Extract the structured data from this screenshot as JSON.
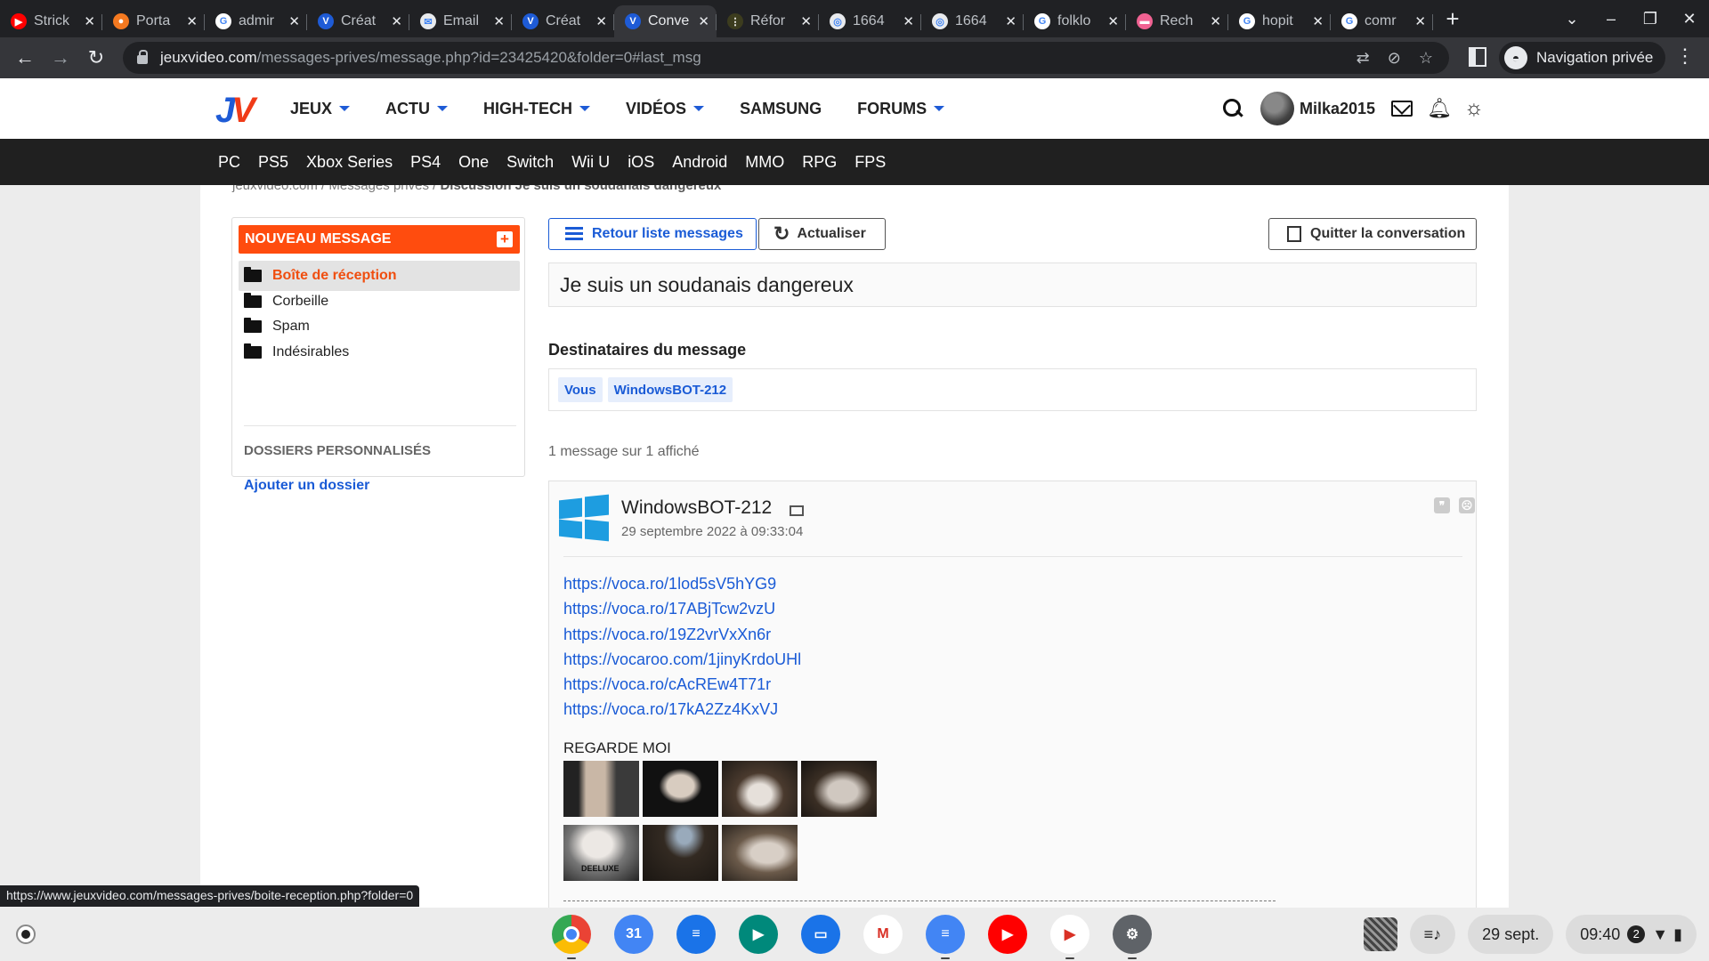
{
  "browser": {
    "tabs": [
      {
        "title": "Strick",
        "favicon_color": "#ff0000",
        "favicon_glyph": "▶"
      },
      {
        "title": "Porta",
        "favicon_color": "#f47920",
        "favicon_glyph": "●"
      },
      {
        "title": "admir",
        "favicon_color": "#ffffff",
        "favicon_glyph": "G"
      },
      {
        "title": "Créat",
        "favicon_color": "#1e5bd6",
        "favicon_glyph": "V"
      },
      {
        "title": "Email",
        "favicon_color": "#e8eaed",
        "favicon_glyph": "✉"
      },
      {
        "title": "Créat",
        "favicon_color": "#1e5bd6",
        "favicon_glyph": "V"
      },
      {
        "title": "Conve",
        "favicon_color": "#1e5bd6",
        "favicon_glyph": "V",
        "active": true
      },
      {
        "title": "Réfor",
        "favicon_color": "#3c3c1e",
        "favicon_glyph": "⋮"
      },
      {
        "title": "1664",
        "favicon_color": "#e8eaed",
        "favicon_glyph": "◎"
      },
      {
        "title": "1664",
        "favicon_color": "#e8eaed",
        "favicon_glyph": "◎"
      },
      {
        "title": "folklo",
        "favicon_color": "#ffffff",
        "favicon_glyph": "G"
      },
      {
        "title": "Rech",
        "favicon_color": "#f06292",
        "favicon_glyph": "▬"
      },
      {
        "title": "hopit",
        "favicon_color": "#ffffff",
        "favicon_glyph": "G"
      },
      {
        "title": "comr",
        "favicon_color": "#ffffff",
        "favicon_glyph": "G"
      }
    ],
    "url_host": "jeuxvideo.com",
    "url_path": "/messages-prives/message.php?id=23425420&folder=0#last_msg",
    "incognito_label": "Navigation privée"
  },
  "header": {
    "logo_j": "J",
    "logo_v": "V",
    "nav": [
      {
        "label": "JEUX",
        "dropdown": true
      },
      {
        "label": "ACTU",
        "dropdown": true
      },
      {
        "label": "HIGH-TECH",
        "dropdown": true
      },
      {
        "label": "VIDÉOS",
        "dropdown": true
      },
      {
        "label": "SAMSUNG",
        "dropdown": false
      },
      {
        "label": "FORUMS",
        "dropdown": true
      }
    ],
    "username": "Milka2015",
    "platforms": [
      "PC",
      "PS5",
      "Xbox Series",
      "PS4",
      "One",
      "Switch",
      "Wii U",
      "iOS",
      "Android",
      "MMO",
      "RPG",
      "FPS"
    ]
  },
  "breadcrumb": {
    "part1": "jeuxvideo.com",
    "part2": "Messages privés",
    "current": "Discussion Je suis un soudanais dangereux"
  },
  "sidebar": {
    "new_message": "NOUVEAU MESSAGE",
    "folders": [
      {
        "label": "Boîte de réception",
        "selected": true
      },
      {
        "label": "Corbeille",
        "selected": false
      },
      {
        "label": "Spam",
        "selected": false
      },
      {
        "label": "Indésirables",
        "selected": false
      }
    ],
    "custom_title": "DOSSIERS PERSONNALISÉS",
    "add_folder": "Ajouter un dossier"
  },
  "actions": {
    "back_label": "Retour liste messages",
    "refresh_label": "Actualiser",
    "quit_label": "Quitter la conversation"
  },
  "conversation": {
    "subject": "Je suis un soudanais dangereux",
    "recipients_title": "Destinataires du message",
    "recipients": [
      "Vous",
      "WindowsBOT-212"
    ],
    "count_text": "1 message sur 1 affiché"
  },
  "message": {
    "author": "WindowsBOT-212",
    "date": "29 septembre 2022 à 09:33:04",
    "links": [
      "https://voca.ro/1lod5sV5hYG9",
      "https://voca.ro/17ABjTcw2vzU",
      "https://voca.ro/19Z2vrVxXn6r",
      "https://vocaroo.com/1jinyKrdoUHl",
      "https://voca.ro/cAcREw4T71r",
      "https://voca.ro/17kA2Zz4KxVJ"
    ],
    "caption": "REGARDE MOI",
    "thumb_caption": "DEELUXE"
  },
  "status_url": "https://www.jeuxvideo.com/messages-prives/boite-reception.php?folder=0",
  "shelf": {
    "apps": [
      {
        "name": "chrome",
        "color": "#e8eaed",
        "running": true
      },
      {
        "name": "calendar",
        "color": "#4285f4",
        "running": false,
        "glyph": "31"
      },
      {
        "name": "messages",
        "color": "#1a73e8",
        "running": false,
        "glyph": "≡"
      },
      {
        "name": "meet",
        "color": "#00897b",
        "running": false,
        "glyph": "▶"
      },
      {
        "name": "files",
        "color": "#1a73e8",
        "running": false,
        "glyph": "▭"
      },
      {
        "name": "gmail",
        "color": "#ffffff",
        "running": false,
        "glyph": "M"
      },
      {
        "name": "docs",
        "color": "#4285f4",
        "running": true,
        "glyph": "≡"
      },
      {
        "name": "youtube",
        "color": "#ff0000",
        "running": false,
        "glyph": "▶"
      },
      {
        "name": "play-store",
        "color": "#ffffff",
        "running": true,
        "glyph": "▶"
      },
      {
        "name": "settings",
        "color": "#5f6368",
        "running": true,
        "glyph": "⚙"
      }
    ],
    "date": "29 sept.",
    "time": "09:40",
    "notif_count": "2"
  }
}
